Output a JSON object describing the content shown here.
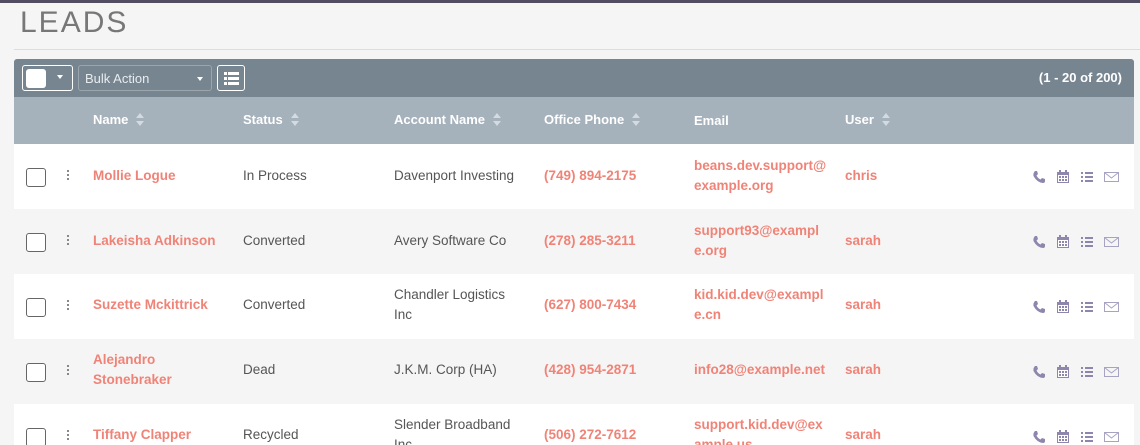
{
  "page": {
    "title": "LEADS"
  },
  "toolbar": {
    "bulk_action_label": "Bulk Action",
    "pagination_text": "(1 - 20 of 200)"
  },
  "columns": {
    "name": "Name",
    "status": "Status",
    "account": "Account Name",
    "phone": "Office Phone",
    "email": "Email",
    "user": "User"
  },
  "rows": [
    {
      "name": "Mollie Logue",
      "status": "In Process",
      "account": "Davenport Investing",
      "phone": "(749) 894-2175",
      "email": "beans.dev.support@example.org",
      "user": "chris"
    },
    {
      "name": "Lakeisha Adkinson",
      "status": "Converted",
      "account": "Avery Software Co",
      "phone": "(278) 285-3211",
      "email": "support93@example.org",
      "user": "sarah"
    },
    {
      "name": "Suzette Mckittrick",
      "status": "Converted",
      "account": "Chandler Logistics Inc",
      "phone": "(627) 800-7434",
      "email": "kid.kid.dev@example.cn",
      "user": "sarah"
    },
    {
      "name": "Alejandro Stonebraker",
      "status": "Dead",
      "account": "J.K.M. Corp (HA)",
      "phone": "(428) 954-2871",
      "email": "info28@example.net",
      "user": "sarah"
    },
    {
      "name": "Tiffany Clapper",
      "status": "Recycled",
      "account": "Slender Broadband Inc",
      "phone": "(506) 272-7612",
      "email": "support.kid.dev@example.us",
      "user": "sarah"
    }
  ],
  "row_action_icons": [
    "phone-icon",
    "calendar-icon",
    "task-list-icon",
    "email-icon"
  ],
  "colors": {
    "link": "#f08377",
    "toolbar": "#778591",
    "header": "#a5b1bb",
    "icon": "#8e86ad"
  }
}
